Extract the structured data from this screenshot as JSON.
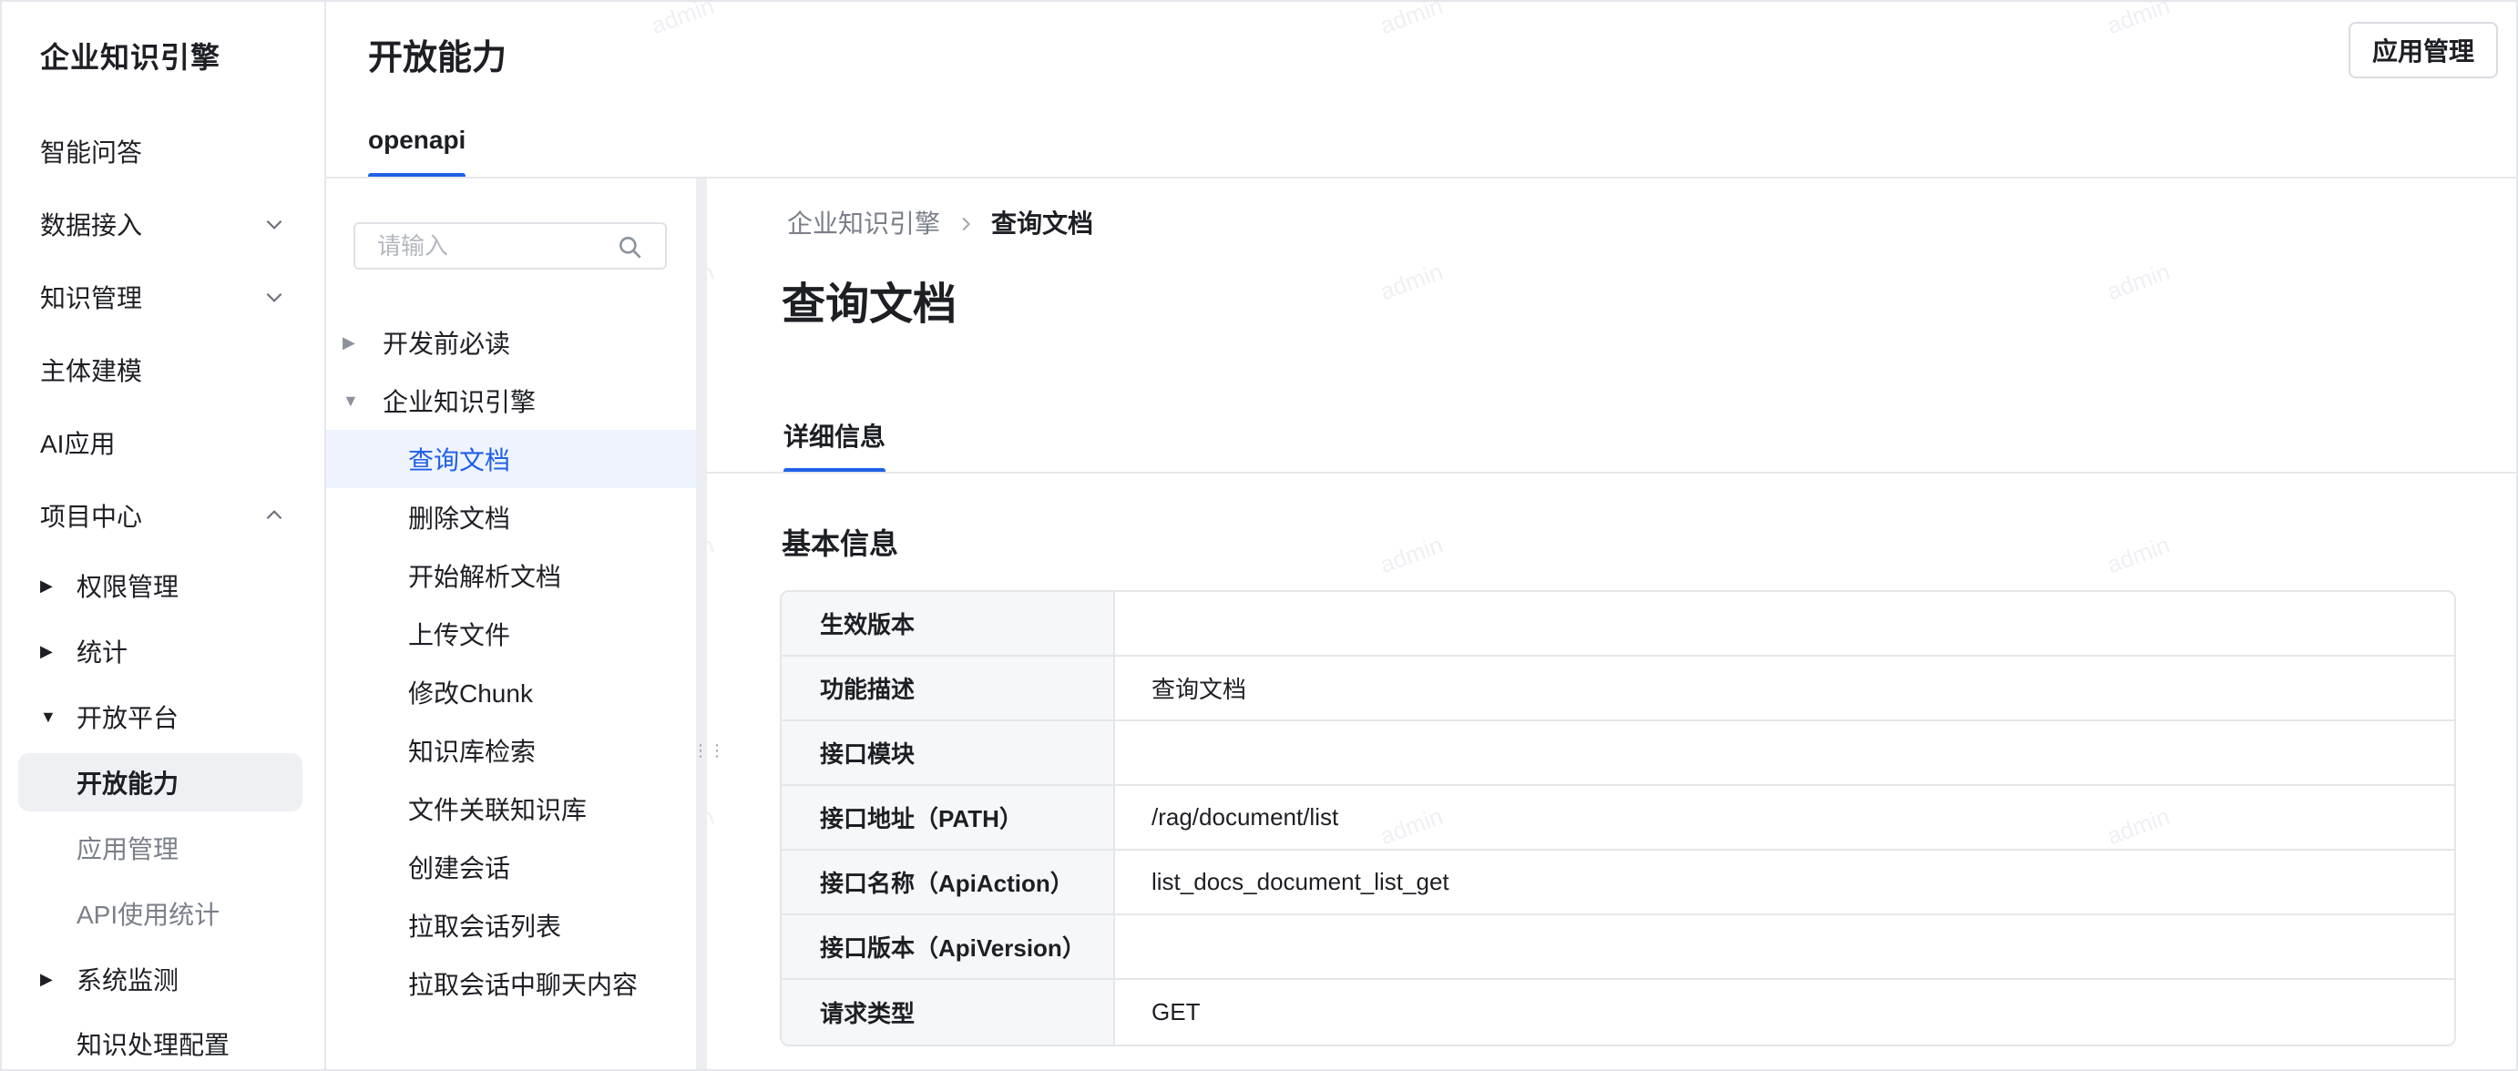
{
  "app": {
    "title": "企业知识引擎"
  },
  "sidebar": {
    "top_items": [
      {
        "label": "智能问答",
        "icon": ""
      },
      {
        "label": "数据接入",
        "icon": "chevron-down-icon"
      },
      {
        "label": "知识管理",
        "icon": "chevron-down-icon"
      },
      {
        "label": "主体建模",
        "icon": ""
      },
      {
        "label": "AI应用",
        "icon": ""
      },
      {
        "label": "项目中心",
        "icon": "chevron-up-icon"
      }
    ],
    "project_center": {
      "groups": [
        {
          "label": "权限管理",
          "expanded": false
        },
        {
          "label": "统计",
          "expanded": false
        },
        {
          "label": "开放平台",
          "expanded": true
        }
      ],
      "open_platform_children": [
        {
          "label": "开放能力",
          "active": true
        },
        {
          "label": "应用管理",
          "active": false
        },
        {
          "label": "API使用统计",
          "active": false
        }
      ],
      "system_monitor": {
        "label": "系统监测",
        "expanded": false
      },
      "knowledge_config": {
        "label": "知识处理配置"
      }
    }
  },
  "header": {
    "title": "开放能力",
    "action_button": "应用管理",
    "tabs": [
      {
        "label": "openapi",
        "active": true
      }
    ]
  },
  "tree": {
    "search_placeholder": "请输入",
    "search_value": "",
    "folders": [
      {
        "label": "开发前必读",
        "expanded": false
      },
      {
        "label": "企业知识引擎",
        "expanded": true
      }
    ],
    "items": [
      {
        "label": "查询文档",
        "active": true
      },
      {
        "label": "删除文档",
        "active": false
      },
      {
        "label": "开始解析文档",
        "active": false
      },
      {
        "label": "上传文件",
        "active": false
      },
      {
        "label": "修改Chunk",
        "active": false
      },
      {
        "label": "知识库检索",
        "active": false
      },
      {
        "label": "文件关联知识库",
        "active": false
      },
      {
        "label": "创建会话",
        "active": false
      },
      {
        "label": "拉取会话列表",
        "active": false
      },
      {
        "label": "拉取会话中聊天内容",
        "active": false
      }
    ]
  },
  "detail": {
    "breadcrumb": {
      "root": "企业知识引擎",
      "current": "查询文档"
    },
    "title": "查询文档",
    "tabs": [
      {
        "label": "详细信息",
        "active": true
      }
    ],
    "section_title": "基本信息",
    "rows": [
      {
        "key": "生效版本",
        "value": ""
      },
      {
        "key": "功能描述",
        "value": "查询文档"
      },
      {
        "key": "接口模块",
        "value": ""
      },
      {
        "key": "接口地址（PATH）",
        "value": "/rag/document/list"
      },
      {
        "key": "接口名称（ApiAction）",
        "value": "list_docs_document_list_get"
      },
      {
        "key": "接口版本（ApiVersion）",
        "value": ""
      },
      {
        "key": "请求类型",
        "value": "GET"
      }
    ]
  },
  "watermark": {
    "text": "admin"
  },
  "colors": {
    "accent": "#1f5fe8",
    "active_bg": "#eef3fe",
    "nav_active_bg": "#eef0f3"
  }
}
